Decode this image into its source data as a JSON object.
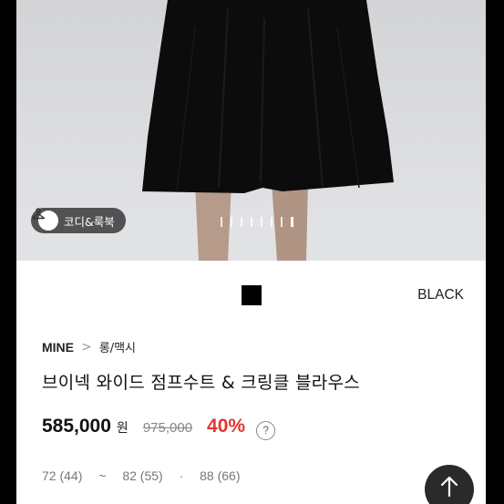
{
  "hero": {
    "coordi_button_label": "코디&룩북",
    "pager_count": 8,
    "pager_active_index": 7
  },
  "option": {
    "color_name": "BLACK",
    "swatch_color": "#000000"
  },
  "breadcrumb": {
    "brand": "MINE",
    "separator": ">",
    "category": "롱/맥시"
  },
  "product": {
    "title": "브이넥 와이드 점프수트 & 크링클 블라우스",
    "price": "585,000",
    "currency": "원",
    "original_price": "975,000",
    "discount": "40%",
    "discount_color": "#e8352e",
    "help_symbol": "?"
  },
  "sizes": [
    "72 (44)",
    "~",
    "82 (55)",
    "·",
    "88 (66)"
  ],
  "fab": {
    "icon": "arrow-up-icon"
  }
}
